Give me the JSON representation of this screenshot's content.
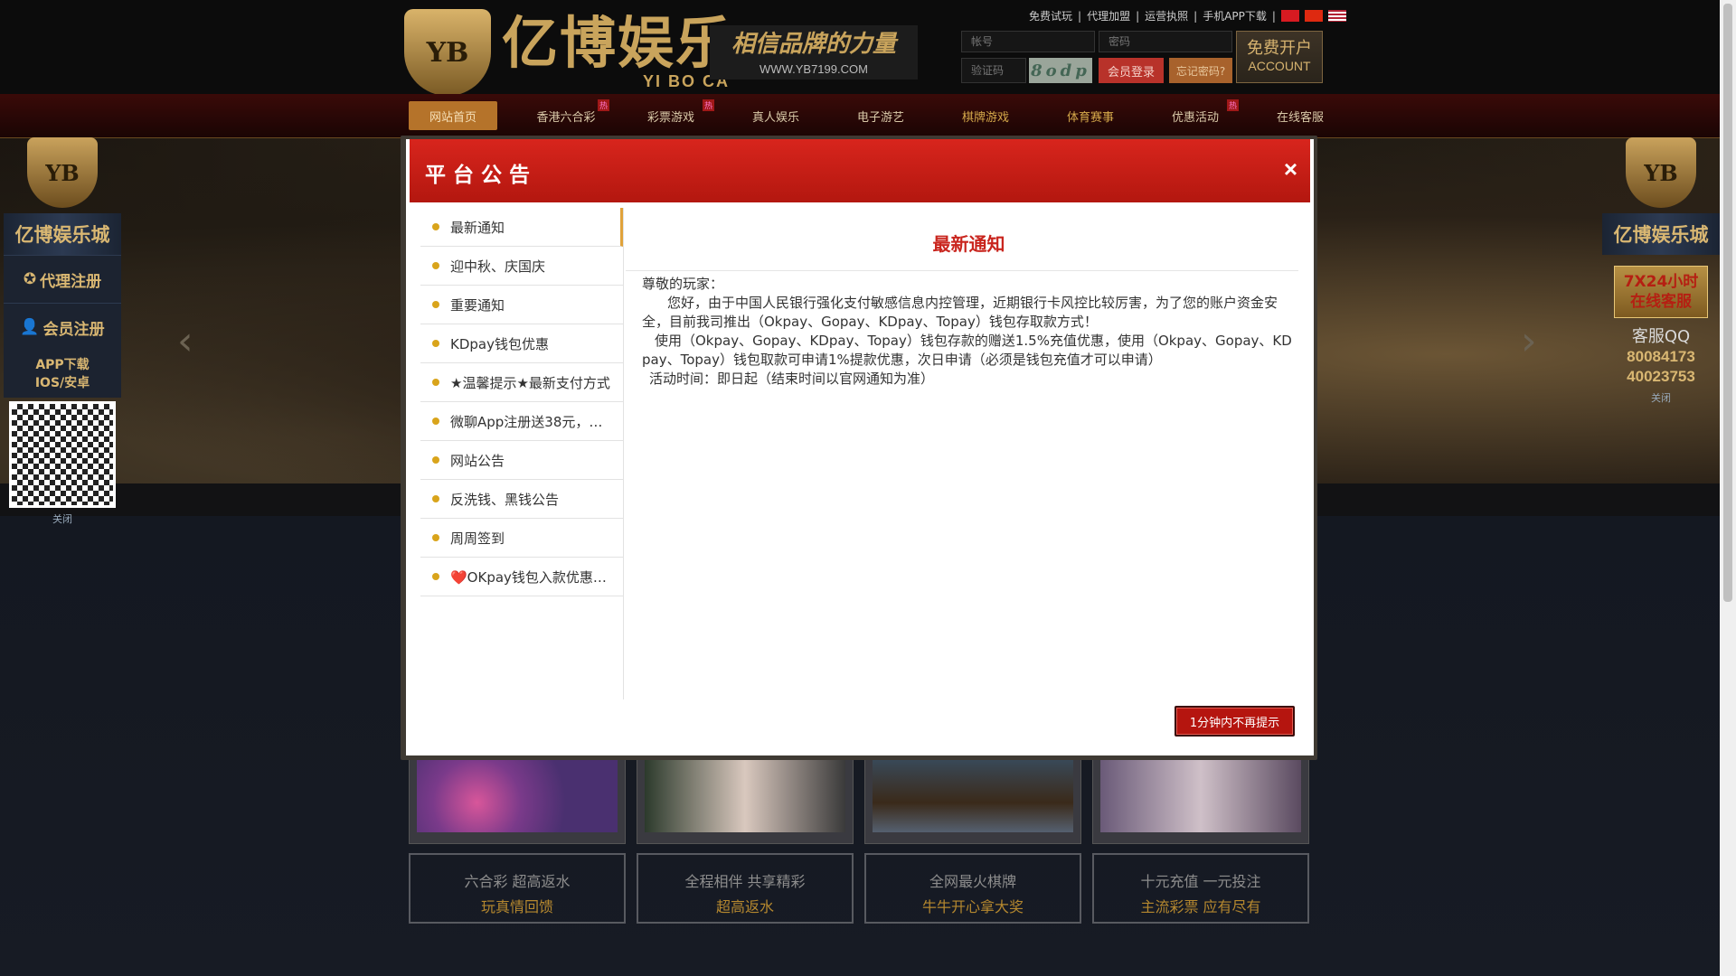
{
  "header": {
    "logo_cn": "亿博娱乐",
    "logo_en": "YI BO CA",
    "logo_badge": "YB",
    "slogan": "相信品牌的力量",
    "slogan_url": "WWW.YB7199.COM",
    "top_links": [
      "免费试玩",
      "代理加盟",
      "运营执照",
      "手机APP下载"
    ],
    "account_placeholder": "帐号",
    "password_placeholder": "密码",
    "captcha_placeholder": "验证码",
    "captcha_text": "8odp",
    "login_label": "会员登录",
    "forgot_label": "忘记密码?",
    "register_cn": "免费开户",
    "register_en": "ACCOUNT"
  },
  "nav": {
    "items": [
      {
        "label": "网站首页",
        "hot": false
      },
      {
        "label": "香港六合彩",
        "hot": true
      },
      {
        "label": "彩票游戏",
        "hot": true
      },
      {
        "label": "真人娱乐",
        "hot": false
      },
      {
        "label": "电子游艺",
        "hot": false
      },
      {
        "label": "棋牌游戏",
        "hot": false
      },
      {
        "label": "体育赛事",
        "hot": false
      },
      {
        "label": "优惠活动",
        "hot": true
      },
      {
        "label": "在线客服",
        "hot": false
      }
    ],
    "hot_label": "热"
  },
  "side_left": {
    "badge": "YB",
    "title": "亿博娱乐城",
    "agent": "代理注册",
    "member": "会员注册",
    "app_line1": "APP下载",
    "app_line2": "IOS/安卓",
    "close": "关闭"
  },
  "side_right": {
    "badge": "YB",
    "title": "亿博娱乐城",
    "cs_line1": "7X24小时",
    "cs_line2": "在线客服",
    "qq_label": "客服QQ",
    "qq1": "80084173",
    "qq2": "40023753",
    "close": "关闭"
  },
  "cards": [
    {
      "line1": "六合彩 超高返水",
      "line2": "玩真情回馈"
    },
    {
      "line1": "全程相伴 共享精彩",
      "line2": "超高返水"
    },
    {
      "line1": "全网最火棋牌",
      "line2": "牛牛开心拿大奖"
    },
    {
      "line1": "十元充值 一元投注",
      "line2": "主流彩票 应有尽有"
    }
  ],
  "modal": {
    "title": "平台公告",
    "close": "×",
    "menu": [
      "最新通知",
      "迎中秋、庆国庆",
      "重要通知",
      "KDpay钱包优惠",
      "★温馨提示★最新支付方式",
      "微聊App注册送38元，…",
      "网站公告",
      "反洗钱、黑钱公告",
      "周周签到",
      "❤️OKpay钱包入款优惠…"
    ],
    "content_title": "最新通知",
    "greeting": "尊敬的玩家：",
    "para1": "您好，由于中国人民银行强化支付敏感信息内控管理，近期银行卡风控比较厉害，为了您的账户资金安全，目前我司推出（Okpay、Gopay、KDpay、Topay）钱包存取款方式！",
    "para2": "使用（Okpay、Gopay、KDpay、Topay）钱包存款的赠送1.5%充值优惠，使用（Okpay、Gopay、KDpay、Topay）钱包取款可申请1%提款优惠，次日申请（必须是钱包充值才可以申请）",
    "para3": "活动时间：即日起（结束时间以官网通知为准）",
    "dismiss_label": "1分钟内不再提示"
  },
  "colors": {
    "modal_header_red": "#c9251e",
    "accent_gold": "#d9a41b",
    "nav_active": "#b5732a"
  }
}
